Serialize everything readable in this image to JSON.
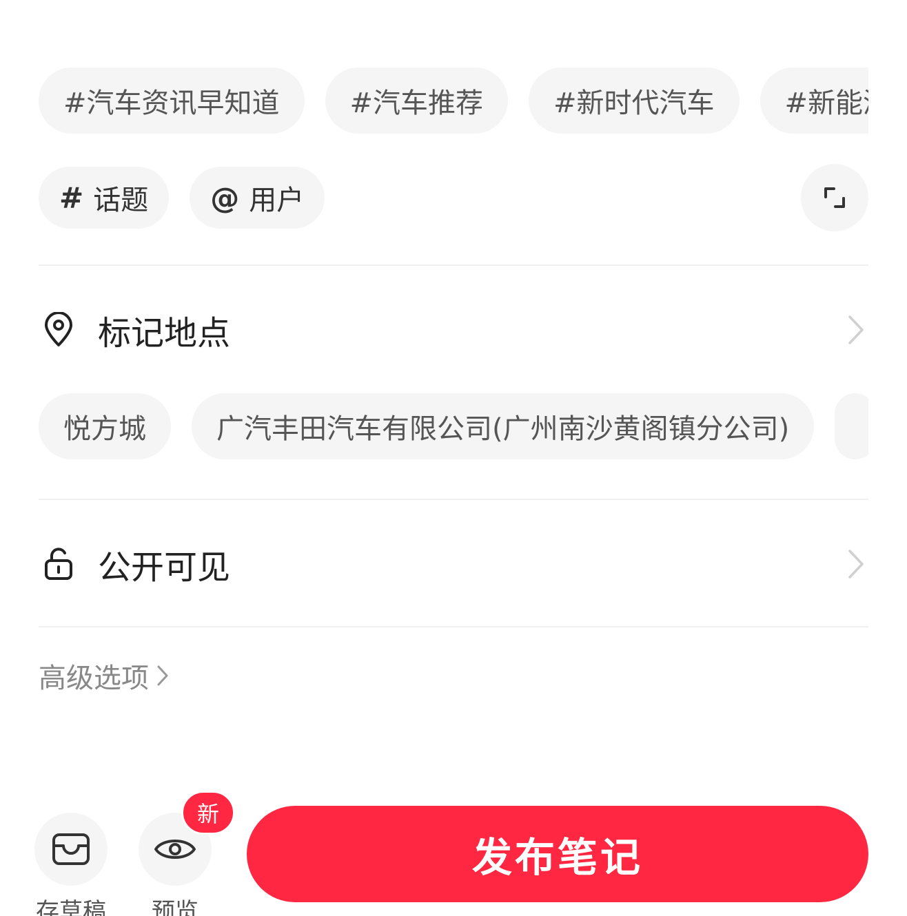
{
  "topics": [
    "#汽车资讯早知道",
    "#汽车推荐",
    "#新时代汽车",
    "#新能源"
  ],
  "tools": {
    "topic": {
      "glyph": "#",
      "label": "话题"
    },
    "user": {
      "glyph": "@",
      "label": "用户"
    }
  },
  "location": {
    "label": "标记地点",
    "icon": "location-pin-icon"
  },
  "places": [
    "悦方城",
    "广汽丰田汽车有限公司(广州南沙黄阁镇分公司)"
  ],
  "privacy": {
    "label": "公开可见",
    "icon": "unlock-icon"
  },
  "advanced": {
    "label": "高级选项"
  },
  "bottom": {
    "draft_label": "存草稿",
    "preview_label": "预览",
    "new_badge": "新",
    "publish_label": "发布笔记"
  },
  "colors": {
    "accent": "#ff2741",
    "chip_bg": "#f5f5f5"
  }
}
